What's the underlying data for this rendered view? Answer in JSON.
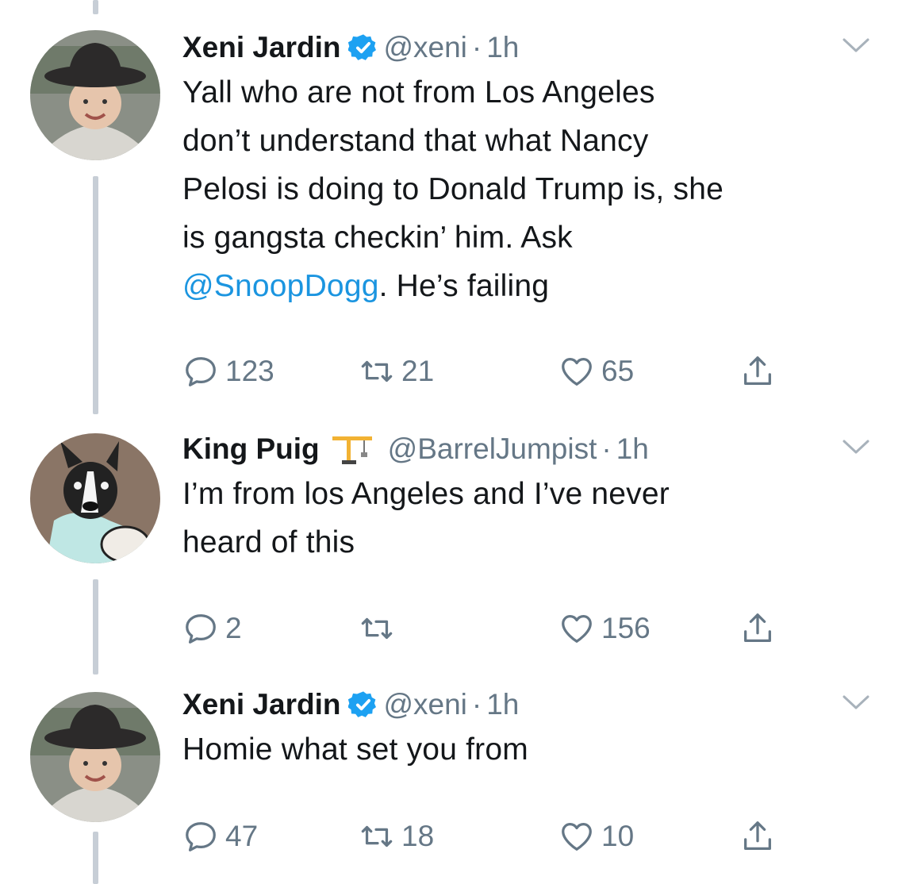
{
  "tweets": [
    {
      "name": "Xeni Jardin",
      "verified": true,
      "handle": "@xeni",
      "time": "1h",
      "text_before": "Yall who are not from Los Angeles\ndon’t understand that what Nancy\nPelosi is doing to Donald Trump is, she\nis gangsta checkin’ him. Ask\n",
      "mention": "@SnoopDogg",
      "text_after": ".  He’s failing",
      "replies": "123",
      "retweets": "21",
      "likes": "65",
      "avatar_icon": "person-wide-brim-hat-avatar"
    },
    {
      "name": "King Puig",
      "verified": false,
      "badge_icon": "crane-emoji-icon",
      "handle": "@BarrelJumpist",
      "time": "1h",
      "text_before": "I’m from los Angeles and I’ve never\nheard of this",
      "replies": "2",
      "retweets": "",
      "likes": "156",
      "avatar_icon": "boston-terrier-avatar"
    },
    {
      "name": "Xeni Jardin",
      "verified": true,
      "handle": "@xeni",
      "time": "1h",
      "text_before": "Homie what set you from",
      "replies": "47",
      "retweets": "18",
      "likes": "10",
      "avatar_icon": "person-wide-brim-hat-avatar"
    }
  ],
  "colors": {
    "link": "#1b95e0",
    "muted": "#657786",
    "verified": "#1da1f2",
    "thread_line": "#c7ced6"
  }
}
